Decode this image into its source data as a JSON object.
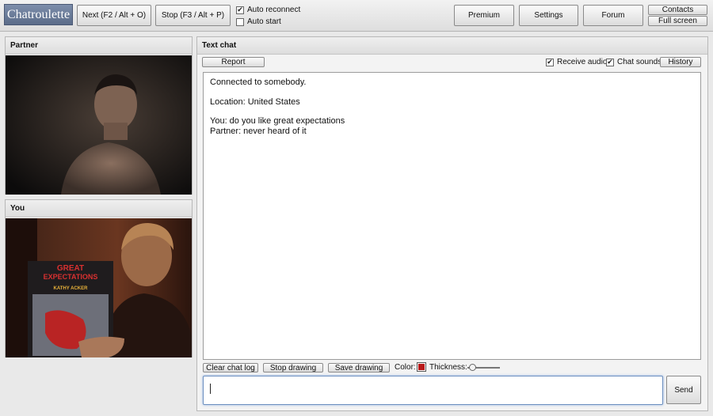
{
  "app": {
    "logo": "Chatroulette"
  },
  "toolbar": {
    "next_label": "Next (F2 / Alt + O)",
    "stop_label": "Stop (F3 / Alt + P)",
    "auto_reconnect": {
      "label": "Auto reconnect",
      "checked": true
    },
    "auto_start": {
      "label": "Auto start",
      "checked": false
    },
    "premium_label": "Premium",
    "settings_label": "Settings",
    "forum_label": "Forum",
    "contacts_label": "Contacts",
    "fullscreen_label": "Full screen"
  },
  "partner_panel": {
    "title": "Partner"
  },
  "you_panel": {
    "title": "You",
    "book_title": "GREAT EXPECTATIONS",
    "book_author": "KATHY ACKER"
  },
  "chat_panel": {
    "title": "Text chat",
    "report_label": "Report",
    "receive_audio": {
      "label": "Receive audio",
      "checked": true
    },
    "chat_sounds": {
      "label": "Chat sounds",
      "checked": true
    },
    "history_label": "History",
    "messages": [
      "Connected to somebody.",
      "Location: United States",
      "You: do you like great expectations",
      "Partner: never heard of it"
    ]
  },
  "drawing_bar": {
    "clear_label": "Clear chat log",
    "stop_drawing_label": "Stop drawing",
    "save_drawing_label": "Save drawing",
    "color_label": "Color:",
    "color_value": "#b81818",
    "thickness_label": "Thickness:"
  },
  "input": {
    "value": "",
    "send_label": "Send"
  },
  "colors": {
    "logo_bg": "#6a7b98",
    "input_focus": "#6c8fbf",
    "panel_border": "#b8b8b8"
  }
}
